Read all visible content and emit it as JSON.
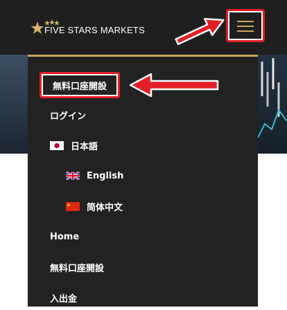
{
  "header": {
    "logo_text": "FIVE STARS MARKETS"
  },
  "menu": {
    "items": [
      {
        "label": "無料口座開設",
        "highlighted": true
      },
      {
        "label": "ログイン"
      },
      {
        "label": "日本語",
        "flag": "japan-flag"
      },
      {
        "label": "English",
        "flag": "uk-flag"
      },
      {
        "label": "简体中文",
        "flag": "china-flag"
      },
      {
        "label": "Home"
      },
      {
        "label": "無料口座開設"
      },
      {
        "label": "入出金"
      }
    ]
  },
  "colors": {
    "header_bg": "#1f1f1f",
    "menu_bg": "#222222",
    "accent_gold": "#c9a75b",
    "annotation_red": "#e41e26"
  }
}
